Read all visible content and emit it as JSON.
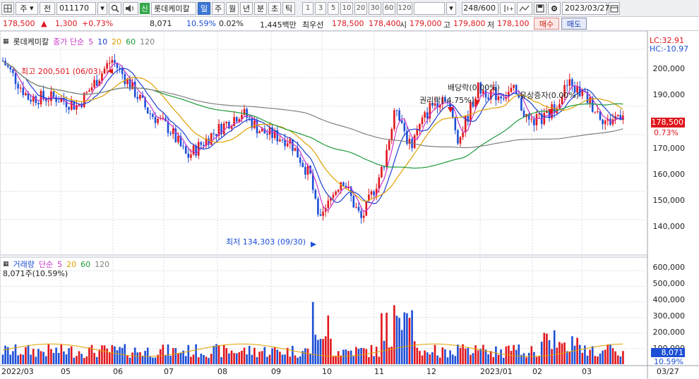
{
  "toolbar": {
    "market": "주",
    "period_label": "전",
    "code": "011170",
    "new_badge": "신",
    "stock_name": "롯데케미칼",
    "periods": [
      "일",
      "주",
      "월",
      "년",
      "분",
      "초",
      "틱"
    ],
    "selected_period": "일",
    "intervals": [
      "1",
      "3",
      "5",
      "10",
      "20",
      "30",
      "60",
      "120"
    ],
    "count": "248/600",
    "date": "2023/03/27"
  },
  "quote": {
    "price": "178,500",
    "arrow": "▲",
    "change": "1,300",
    "change_pct": "+0.73%",
    "volume": "8,071",
    "vol_ratio": "10.59%",
    "turnover": "0.02%",
    "amount": "1,445백만",
    "priority_label": "최우선",
    "ask": "178,500",
    "bid": "178,400",
    "open_label": "시",
    "open": "179,000",
    "high_label": "고",
    "high": "179,800",
    "low_label": "저",
    "low": "178,100",
    "buy_label": "매수",
    "sell_label": "매도"
  },
  "price_panel": {
    "legend_name": "롯데케미칼",
    "legend_ma_label": "종가 단순",
    "ma_periods": [
      "5",
      "10",
      "20",
      "60",
      "120"
    ],
    "ma_colors": [
      "#c837c8",
      "#1d3fd0",
      "#e0a000",
      "#1f9a3a",
      "#808080"
    ],
    "lc": "LC:32.91",
    "hc": "HC:-10.97",
    "y_ticks": [
      "200,000",
      "190,000",
      "180,000",
      "170,000",
      "160,000",
      "150,000",
      "140,000"
    ],
    "last_price_tag": "178,500",
    "last_pct_tag": "0.73%",
    "annotations": {
      "high": "최고 200,501 (06/03)",
      "low": "최저 134,303 (09/30)",
      "dividend": "배당락(0.00%)",
      "rights": "권리락(-4.75%)",
      "capital": "유상증자(0.00%)"
    }
  },
  "volume_panel": {
    "legend_name": "거래량",
    "legend_ma_label": "단순",
    "ma_periods": [
      "5",
      "20",
      "60",
      "120"
    ],
    "current": "8,071주(10.59%)",
    "y_ticks": [
      "600,000",
      "500,000",
      "400,000",
      "300,000",
      "200,000",
      "100,000"
    ],
    "last_tag": "8,071",
    "last_pct_tag": "10.59%"
  },
  "x_axis": [
    "2022/03",
    "05",
    "06",
    "07",
    "08",
    "09",
    "10",
    "11",
    "12",
    "2023/01",
    "02",
    "03",
    "03/27"
  ],
  "colors": {
    "up": "#e0161d",
    "down": "#1d4fd6",
    "grid": "#d7dbe2"
  }
}
